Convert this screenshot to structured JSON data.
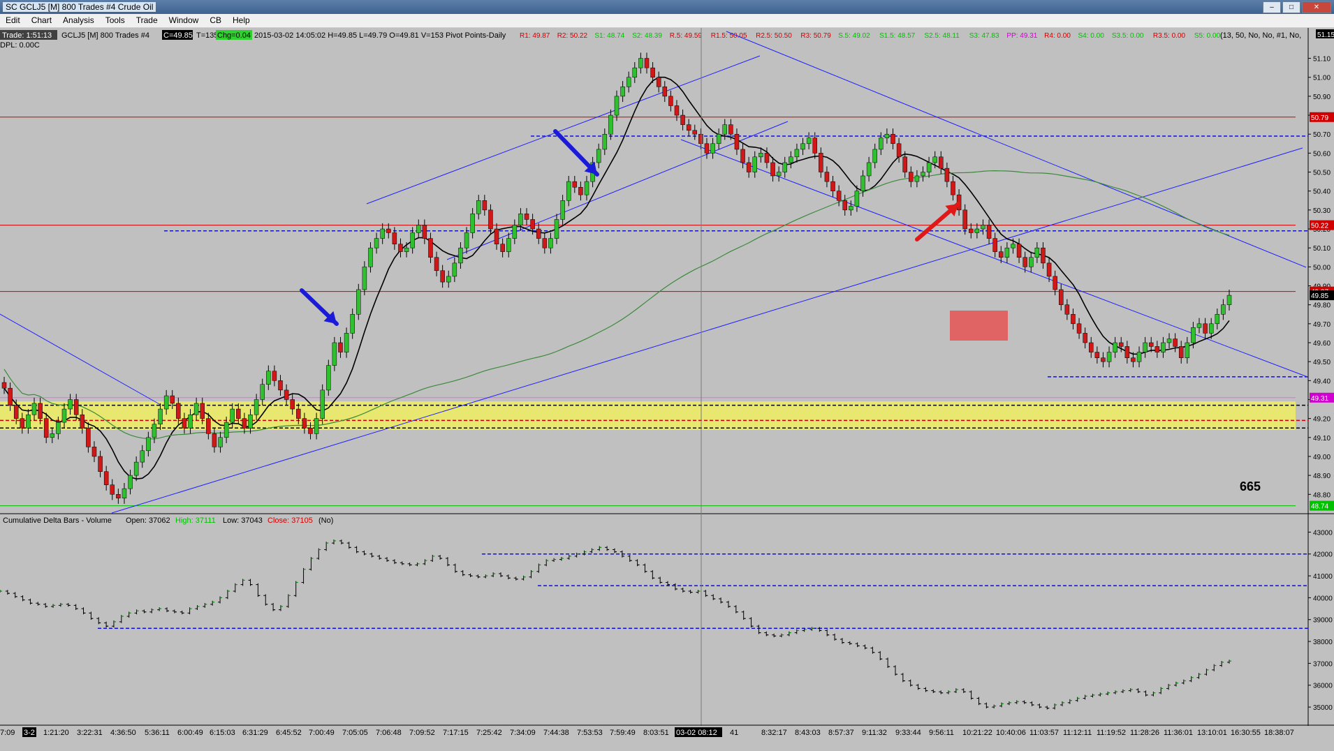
{
  "window": {
    "title": "SC GCLJ5 [M]  800 Trades  #4  Crude Oil",
    "buttons": [
      "–",
      "□",
      "✕"
    ]
  },
  "menu": [
    "Edit",
    "Chart",
    "Analysis",
    "Tools",
    "Trade",
    "Window",
    "CB",
    "Help"
  ],
  "header": {
    "trade": "Trade: 1:51:13",
    "symbol": "GCLJ5 [M]  800 Trades  #4",
    "c": "C=49.85",
    "t": "T=135",
    "chg": "Chg=0.04",
    "ohlc": "2015-03-02  14:05:02  H=49.85  L=49.79  O=49.81  V=153  Pivot Points-Daily",
    "pivots": [
      {
        "text": "R1: 49.87",
        "color": "#d00000"
      },
      {
        "text": "R2: 50.22",
        "color": "#d00000"
      },
      {
        "text": "S1: 48.74",
        "color": "#00c000"
      },
      {
        "text": "S2: 48.39",
        "color": "#00c000"
      },
      {
        "text": "R.5: 49.59",
        "color": "#d00000"
      },
      {
        "text": "R1.5: 50.05",
        "color": "#d00000"
      },
      {
        "text": "R2.5: 50.50",
        "color": "#d00000"
      },
      {
        "text": "R3: 50.79",
        "color": "#d00000"
      },
      {
        "text": "S.5: 49.02",
        "color": "#00c000"
      },
      {
        "text": "S1.5: 48.57",
        "color": "#00c000"
      },
      {
        "text": "S2.5: 48.11",
        "color": "#00c000"
      },
      {
        "text": "S3: 47.83",
        "color": "#00c000"
      },
      {
        "text": "PP: 49.31",
        "color": "#d000d0"
      },
      {
        "text": "R4: 0.00",
        "color": "#d00000"
      },
      {
        "text": "S4: 0.00",
        "color": "#00c000"
      },
      {
        "text": "S3.5: 0.00",
        "color": "#00c000"
      },
      {
        "text": "R3.5: 0.00",
        "color": "#d00000"
      },
      {
        "text": "S5: 0.00",
        "color": "#00c000"
      }
    ],
    "params": "(13, 50, No, No, #1, No,",
    "dpl": "DPL: 0.00C"
  },
  "annotations": {
    "count_label": "665",
    "corner_price": "51.15"
  },
  "indicator": {
    "name": "Cumulative Delta Bars - Volume",
    "open": "Open: 37062",
    "high": "High: 37111",
    "low": "Low: 37043",
    "close": "Close: 37105",
    "extra": "(No)"
  },
  "time_axis": {
    "labels": [
      "7:09",
      "3-2",
      "1:21:20",
      "3:22:31",
      "4:36:50",
      "5:36:11",
      "6:00:49",
      "6:15:03",
      "6:31:29",
      "6:45:52",
      "7:00:49",
      "7:05:05",
      "7:06:48",
      "7:09:52",
      "7:17:15",
      "7:25:42",
      "7:34:09",
      "7:44:38",
      "7:53:53",
      "7:59:49",
      "8:03:51",
      "03-02  08:12",
      "41",
      "8:32:17",
      "8:43:03",
      "8:57:37",
      "9:11:32",
      "9:33:44",
      "9:56:11",
      "10:21:22",
      "10:40:06",
      "11:03:57",
      "11:12:11",
      "11:19:52",
      "11:28:26",
      "11:36:01",
      "13:10:01",
      "16:30:55",
      "18:38:07"
    ]
  },
  "colors": {
    "background": "#c0c0c0",
    "up": "#2fbf2f",
    "down": "#d01818",
    "resistance": "#d00000",
    "support": "#00c000",
    "pivot": "#ee66ee",
    "dashed": "#1010d0",
    "trendline": "#2020ff",
    "zone": "#e8e870"
  },
  "chart_data": [
    {
      "type": "candlestick",
      "title": "SC GCLJ5 [M] 800 Trades #4 Crude Oil",
      "ylim": [
        48.72,
        51.15
      ],
      "y_ticks": [
        48.8,
        48.9,
        49.0,
        49.1,
        49.2,
        49.3,
        49.4,
        49.5,
        49.6,
        49.7,
        49.8,
        49.9,
        50.0,
        50.1,
        50.2,
        50.3,
        50.4,
        50.5,
        50.6,
        50.7,
        50.8,
        50.9,
        51.0,
        51.1
      ],
      "price_markers": [
        {
          "label": "50.79",
          "value": 50.79,
          "color": "#d00000"
        },
        {
          "label": "50.22",
          "value": 50.22,
          "color": "#d00000"
        },
        {
          "label": "49.87",
          "value": 49.87,
          "color": "#d00000"
        },
        {
          "label": "49.85",
          "value": 49.85,
          "color": "#000000"
        },
        {
          "label": "49.31",
          "value": 49.31,
          "color": "#d000d0"
        },
        {
          "label": "48.74",
          "value": 48.74,
          "color": "#00c000"
        }
      ],
      "series": [
        {
          "name": "close",
          "values": [
            49.36,
            49.27,
            49.2,
            49.15,
            49.22,
            49.28,
            49.2,
            49.1,
            49.12,
            49.18,
            49.25,
            49.3,
            49.22,
            49.15,
            49.05,
            49.0,
            48.92,
            48.85,
            48.8,
            48.78,
            48.83,
            48.9,
            48.97,
            49.03,
            49.1,
            49.17,
            49.25,
            49.32,
            49.28,
            49.2,
            49.15,
            49.22,
            49.28,
            49.2,
            49.12,
            49.05,
            49.1,
            49.18,
            49.25,
            49.2,
            49.15,
            49.22,
            49.3,
            49.38,
            49.45,
            49.4,
            49.35,
            49.3,
            49.25,
            49.2,
            49.15,
            49.12,
            49.2,
            49.35,
            49.48,
            49.6,
            49.55,
            49.65,
            49.75,
            49.88,
            50.0,
            50.1,
            50.15,
            50.2,
            50.18,
            50.12,
            50.08,
            50.1,
            50.18,
            50.22,
            50.15,
            50.05,
            49.98,
            49.92,
            49.95,
            50.02,
            50.1,
            50.18,
            50.28,
            50.35,
            50.3,
            50.2,
            50.12,
            50.08,
            50.15,
            50.22,
            50.28,
            50.25,
            50.2,
            50.15,
            50.1,
            50.15,
            50.25,
            50.35,
            50.45,
            50.42,
            50.38,
            50.45,
            50.55,
            50.62,
            50.7,
            50.8,
            50.9,
            50.95,
            51.0,
            51.05,
            51.1,
            51.05,
            51.0,
            50.95,
            50.9,
            50.85,
            50.8,
            50.75,
            50.72,
            50.7,
            50.65,
            50.6,
            50.65,
            50.7,
            50.75,
            50.7,
            50.62,
            50.55,
            50.5,
            50.58,
            50.6,
            50.55,
            50.48,
            50.5,
            50.55,
            50.58,
            50.62,
            50.65,
            50.68,
            50.6,
            50.5,
            50.45,
            50.4,
            50.35,
            50.3,
            50.32,
            50.4,
            50.48,
            50.55,
            50.62,
            50.68,
            50.7,
            50.65,
            50.58,
            50.5,
            50.45,
            50.48,
            50.5,
            50.55,
            50.58,
            50.52,
            50.45,
            50.38,
            50.3,
            50.2,
            50.18,
            50.2,
            50.22,
            50.15,
            50.08,
            50.05,
            50.1,
            50.12,
            50.05,
            50.0,
            50.05,
            50.1,
            50.02,
            49.95,
            49.88,
            49.8,
            49.75,
            49.7,
            49.65,
            49.6,
            49.55,
            49.52,
            49.5,
            49.55,
            49.6,
            49.58,
            49.52,
            49.5,
            49.55,
            49.6,
            49.58,
            49.55,
            49.6,
            49.62,
            49.58,
            49.52,
            49.6,
            49.68,
            49.7,
            49.65,
            49.7,
            49.75,
            49.8,
            49.85
          ]
        }
      ],
      "overlays": [
        {
          "name": "moving_average_short",
          "color": "#000000"
        },
        {
          "name": "moving_average_long",
          "color": "#3a8a3a"
        }
      ]
    },
    {
      "type": "line",
      "title": "Cumulative Delta Bars - Volume",
      "ylim": [
        34300,
        43300
      ],
      "y_ticks": [
        35000,
        36000,
        37000,
        38000,
        39000,
        40000,
        41000,
        42000,
        43000
      ],
      "series": [
        {
          "name": "Cumulative Delta",
          "values": [
            40300,
            40200,
            40050,
            39900,
            39750,
            39700,
            39600,
            39650,
            39700,
            39650,
            39500,
            39300,
            39050,
            38850,
            38700,
            38900,
            39150,
            39300,
            39400,
            39350,
            39450,
            39500,
            39400,
            39350,
            39300,
            39500,
            39600,
            39700,
            39800,
            40000,
            40300,
            40600,
            40800,
            40600,
            40100,
            39700,
            39450,
            39600,
            40100,
            40700,
            41300,
            41800,
            42200,
            42500,
            42600,
            42500,
            42300,
            42100,
            42000,
            41900,
            41800,
            41700,
            41600,
            41550,
            41500,
            41550,
            41700,
            41900,
            41800,
            41500,
            41200,
            41050,
            41000,
            40950,
            41000,
            41100,
            41000,
            40900,
            40850,
            40950,
            41200,
            41500,
            41700,
            41750,
            41800,
            41900,
            42000,
            42100,
            42200,
            42300,
            42200,
            42100,
            41900,
            41700,
            41500,
            41200,
            40900,
            40700,
            40600,
            40400,
            40300,
            40250,
            40300,
            40100,
            39950,
            39800,
            39600,
            39350,
            39050,
            38700,
            38400,
            38300,
            38250,
            38300,
            38400,
            38500,
            38550,
            38600,
            38500,
            38300,
            38100,
            37950,
            37900,
            37800,
            37700,
            37500,
            37200,
            36850,
            36500,
            36200,
            36000,
            35850,
            35750,
            35700,
            35650,
            35700,
            35800,
            35700,
            35400,
            35150,
            35000,
            35050,
            35150,
            35200,
            35250,
            35200,
            35100,
            35000,
            34950,
            35100,
            35200,
            35300,
            35400,
            35500,
            35550,
            35600,
            35650,
            35700,
            35750,
            35800,
            35700,
            35550,
            35650,
            35850,
            36000,
            36100,
            36200,
            36350,
            36500,
            36700,
            36900,
            37050,
            37105
          ]
        }
      ]
    }
  ]
}
